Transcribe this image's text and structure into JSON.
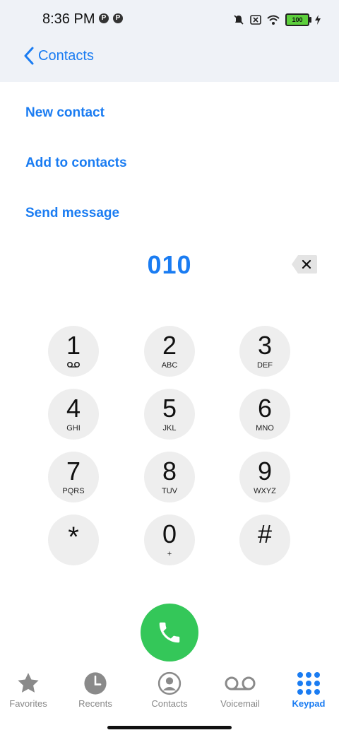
{
  "status_bar": {
    "time": "8:36 PM",
    "battery": "100"
  },
  "nav": {
    "back_label": "Contacts"
  },
  "actions": {
    "new_contact": "New contact",
    "add_to_contacts": "Add to contacts",
    "send_message": "Send message"
  },
  "dialer": {
    "number": "010"
  },
  "keys": [
    {
      "digit": "1",
      "letters": ""
    },
    {
      "digit": "2",
      "letters": "ABC"
    },
    {
      "digit": "3",
      "letters": "DEF"
    },
    {
      "digit": "4",
      "letters": "GHI"
    },
    {
      "digit": "5",
      "letters": "JKL"
    },
    {
      "digit": "6",
      "letters": "MNO"
    },
    {
      "digit": "7",
      "letters": "PQRS"
    },
    {
      "digit": "8",
      "letters": "TUV"
    },
    {
      "digit": "9",
      "letters": "WXYZ"
    },
    {
      "digit": "*",
      "letters": ""
    },
    {
      "digit": "0",
      "letters": "+"
    },
    {
      "digit": "#",
      "letters": ""
    }
  ],
  "tabs": [
    {
      "label": "Favorites",
      "icon": "star-icon"
    },
    {
      "label": "Recents",
      "icon": "clock-icon"
    },
    {
      "label": "Contacts",
      "icon": "person-icon"
    },
    {
      "label": "Voicemail",
      "icon": "voicemail-icon"
    },
    {
      "label": "Keypad",
      "icon": "keypad-icon",
      "active": true
    }
  ],
  "colors": {
    "accent": "#1a7cf2",
    "call": "#34c759",
    "key_bg": "#eeeeee"
  }
}
